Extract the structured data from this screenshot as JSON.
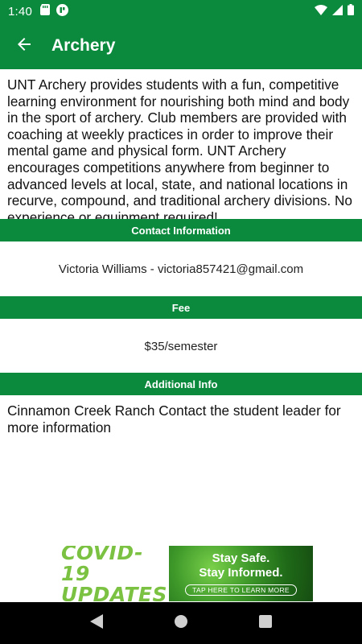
{
  "status_bar": {
    "time": "1:40",
    "icons": [
      "sd-card-icon",
      "app-notification-icon",
      "wifi-icon",
      "signal-icon",
      "battery-icon"
    ]
  },
  "app_bar": {
    "title": "Archery",
    "back_icon": "arrow-left-icon"
  },
  "description": "UNT Archery provides students with a fun, competitive learning environment for nourishing both mind and body in the sport of archery. Club members are provided with coaching at weekly practices in order to improve their mental game and physical form. UNT Archery encourages competitions anywhere from beginner to advanced levels at local, state, and national locations in recurve, compound, and traditional archery divisions. No experience or equipment required!",
  "sections": {
    "contact": {
      "header": "Contact Information",
      "value": "Victoria Williams - victoria857421@gmail.com"
    },
    "fee": {
      "header": "Fee",
      "value": "$35/semester"
    },
    "additional": {
      "header": "Additional Info",
      "value": "Cinnamon Creek Ranch Contact the student leader for more information"
    }
  },
  "ad": {
    "line1": "COVID-19",
    "line2": "UPDATES",
    "stay1": "Stay Safe.",
    "stay2": "Stay Informed.",
    "cta": "TAP HERE TO LEARN MORE"
  },
  "nav_bar": {
    "buttons": [
      "back-triangle-icon",
      "home-circle-icon",
      "recents-square-icon"
    ]
  },
  "colors": {
    "primary_green": "#0b8a3e",
    "ad_green": "#7cc242"
  }
}
